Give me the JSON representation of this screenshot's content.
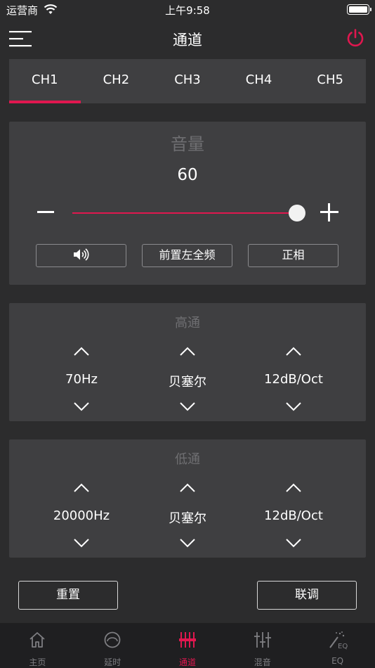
{
  "status_bar": {
    "carrier": "运营商",
    "time": "上午9:58"
  },
  "nav": {
    "title": "通道"
  },
  "channels": [
    "CH1",
    "CH2",
    "CH3",
    "CH4",
    "CH5"
  ],
  "volume": {
    "title": "音量",
    "value": "60",
    "level_fraction": 1.0,
    "buttons": {
      "position": "前置左全频",
      "phase": "正相"
    }
  },
  "high_pass": {
    "title": "高通",
    "frequency": "70Hz",
    "type": "贝塞尔",
    "slope": "12dB/Oct"
  },
  "low_pass": {
    "title": "低通",
    "frequency": "20000Hz",
    "type": "贝塞尔",
    "slope": "12dB/Oct"
  },
  "actions": {
    "reset": "重置",
    "link": "联调"
  },
  "tab_bar": {
    "home": "主页",
    "delay": "延时",
    "channel": "通道",
    "mix": "混音",
    "eq": "EQ"
  },
  "colors": {
    "accent": "#e0174f",
    "background": "#2c2c2d",
    "card": "#3f3f41"
  }
}
